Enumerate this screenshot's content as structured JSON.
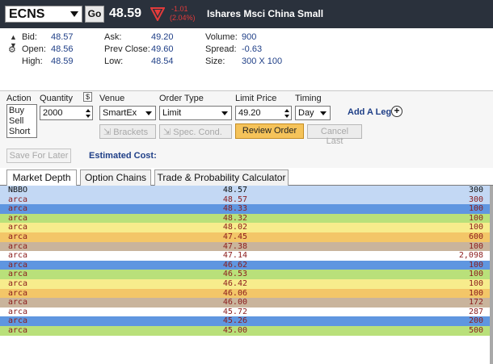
{
  "header": {
    "symbol": "ECNS",
    "go_label": "Go",
    "last": "48.59",
    "change": "-1.01",
    "change_pct": "(2.04%)",
    "name": "Ishares Msci China Small",
    "down_color": "#e33b3b"
  },
  "quote": {
    "bid_label": "Bid:",
    "bid": "48.57",
    "open_label": "Open:",
    "open": "48.56",
    "high_label": "High:",
    "high": "48.59",
    "ask_label": "Ask:",
    "ask": "49.20",
    "prev_label": "Prev Close:",
    "prev": "49.60",
    "low_label": "Low:",
    "low": "48.54",
    "volume_label": "Volume:",
    "volume": "900",
    "spread_label": "Spread:",
    "spread": "-0.63",
    "size_label": "Size:",
    "size": "300 X 100",
    "icons": [
      "up-down-arrows-icon",
      "gear-icon"
    ]
  },
  "order": {
    "action_label": "Action",
    "actions": [
      "Buy",
      "Sell",
      "Short"
    ],
    "quantity_label": "Quantity",
    "quantity_dollar": "$",
    "quantity": "2000",
    "venue_label": "Venue",
    "venue": "SmartEx",
    "order_type_label": "Order Type",
    "order_type": "Limit",
    "limit_label": "Limit Price",
    "limit": "49.20",
    "timing_label": "Timing",
    "timing": "Day",
    "add_leg": "Add A Leg",
    "brackets": "Brackets",
    "spec_cond": "Spec. Cond.",
    "review": "Review Order",
    "cancel_last": "Cancel Last",
    "save_later": "Save For Later",
    "est_cost": "Estimated Cost:"
  },
  "tabs": [
    "Market Depth",
    "Option Chains",
    "Trade & Probability Calculator"
  ],
  "depth": {
    "rows": [
      {
        "exch": "NBBO",
        "price": "48.57",
        "size": "300",
        "bg": "#c3d8f4",
        "color": "#111111"
      },
      {
        "exch": "arca",
        "price": "48.57",
        "size": "300",
        "bg": "#c3d8f4",
        "color": "#8b1c1c"
      },
      {
        "exch": "arca",
        "price": "48.33",
        "size": "100",
        "bg": "#5f96e0",
        "color": "#8b1c1c"
      },
      {
        "exch": "arca",
        "price": "48.32",
        "size": "100",
        "bg": "#b9e07a",
        "color": "#8b1c1c"
      },
      {
        "exch": "arca",
        "price": "48.02",
        "size": "100",
        "bg": "#f7ec8c",
        "color": "#8b1c1c"
      },
      {
        "exch": "arca",
        "price": "47.45",
        "size": "600",
        "bg": "#f3c668",
        "color": "#8b1c1c"
      },
      {
        "exch": "arca",
        "price": "47.38",
        "size": "100",
        "bg": "#c9b49c",
        "color": "#8b1c1c"
      },
      {
        "exch": "arca",
        "price": "47.14",
        "size": "2,098",
        "bg": "#ffffff",
        "color": "#8b1c1c"
      },
      {
        "exch": "arca",
        "price": "46.62",
        "size": "100",
        "bg": "#5f96e0",
        "color": "#8b1c1c"
      },
      {
        "exch": "arca",
        "price": "46.53",
        "size": "100",
        "bg": "#b9e07a",
        "color": "#8b1c1c"
      },
      {
        "exch": "arca",
        "price": "46.42",
        "size": "100",
        "bg": "#f7ec8c",
        "color": "#8b1c1c"
      },
      {
        "exch": "arca",
        "price": "46.06",
        "size": "100",
        "bg": "#f3c668",
        "color": "#8b1c1c"
      },
      {
        "exch": "arca",
        "price": "46.00",
        "size": "172",
        "bg": "#c9b49c",
        "color": "#8b1c1c"
      },
      {
        "exch": "arca",
        "price": "45.72",
        "size": "287",
        "bg": "#ffffff",
        "color": "#8b1c1c"
      },
      {
        "exch": "arca",
        "price": "45.26",
        "size": "200",
        "bg": "#5f96e0",
        "color": "#8b1c1c"
      },
      {
        "exch": "arca",
        "price": "45.00",
        "size": "500",
        "bg": "#b9e07a",
        "color": "#8b1c1c"
      }
    ]
  }
}
